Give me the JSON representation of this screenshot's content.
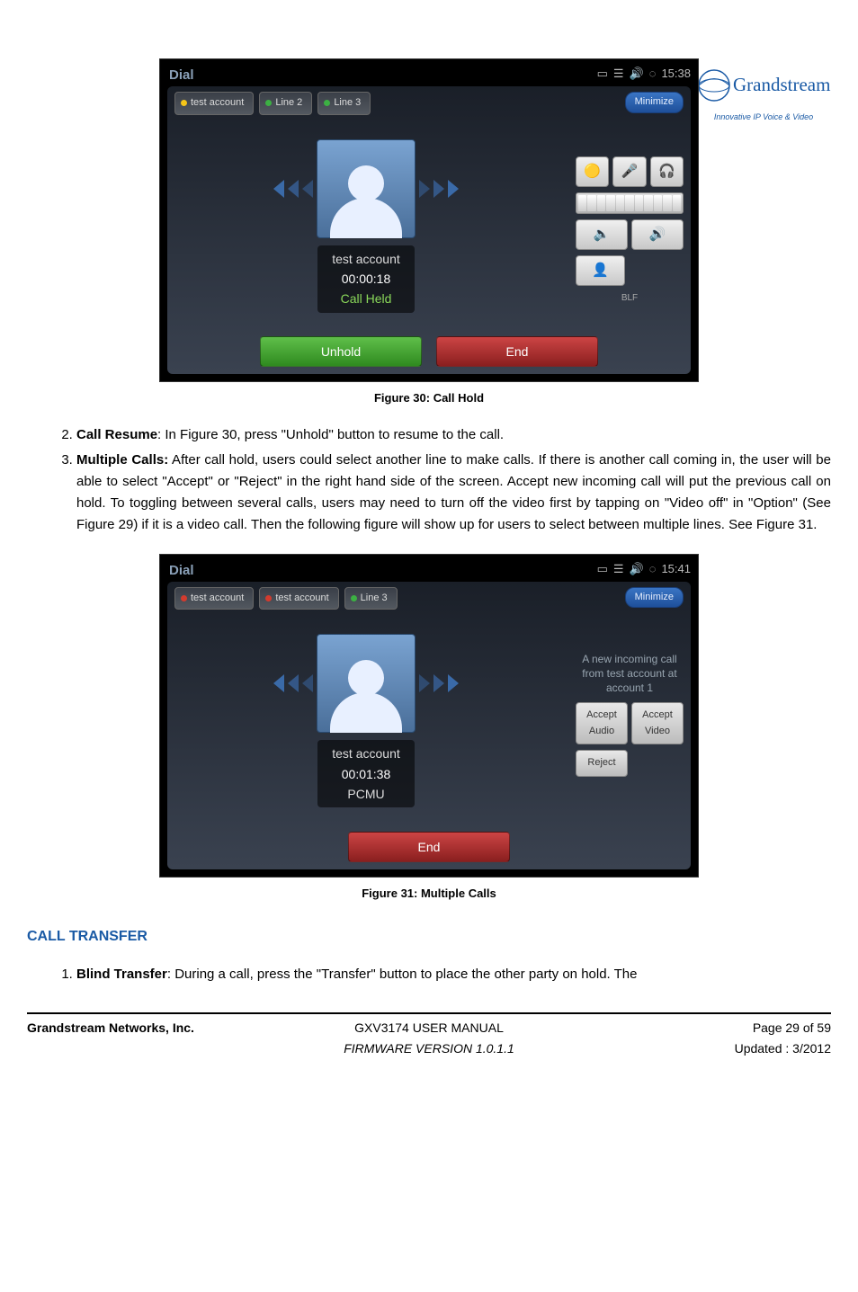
{
  "logo": {
    "brand": "Grandstream",
    "tag": "Innovative IP Voice & Video"
  },
  "fig30": {
    "caption": "Figure 30: Call Hold",
    "window_title": "Dial",
    "clock": "15:38",
    "minimize": "Minimize",
    "tabs": [
      {
        "label": "test account",
        "color": "yellow"
      },
      {
        "label": "Line 2",
        "color": "green"
      },
      {
        "label": "Line 3",
        "color": "green"
      }
    ],
    "call": {
      "name": "test account",
      "time": "00:00:18",
      "status": "Call Held"
    },
    "side_label": "BLF",
    "buttons": {
      "unhold": "Unhold",
      "end": "End"
    }
  },
  "fig31": {
    "caption": "Figure 31: Multiple Calls",
    "window_title": "Dial",
    "clock": "15:41",
    "minimize": "Minimize",
    "tabs": [
      {
        "label": "test account",
        "color": "red"
      },
      {
        "label": "test account",
        "color": "red"
      },
      {
        "label": "Line 3",
        "color": "green"
      }
    ],
    "call": {
      "name": "test account",
      "time": "00:01:38",
      "status": "PCMU"
    },
    "side_info": "A new incoming call from test account at account 1",
    "side_buttons": {
      "accept_audio": "Accept Audio",
      "accept_video": "Accept Video",
      "reject": "Reject"
    },
    "buttons": {
      "end": "End"
    }
  },
  "text": {
    "item2_label": "Call Resume",
    "item2_body": ": In Figure 30, press \"Unhold\" button to resume to the call.",
    "item3_label": "Multiple Calls:",
    "item3_body": " After call hold, users could select another line to make calls. If there is another call coming in, the user will be able to select \"Accept\" or \"Reject\" in the right hand side of the screen. Accept new incoming call will put the previous call on hold. To toggling between several calls, users may need to turn off the video first by tapping on \"Video off\" in \"Option\" (See Figure 29) if it is a video call. Then the following figure will show up for users to select between multiple lines. See Figure 31.",
    "section_heading": "CALL TRANSFER",
    "transfer_item1_label": "Blind Transfer",
    "transfer_item1_body": ": During a call, press the \"Transfer\" button to place the other party on hold. The"
  },
  "footer": {
    "company": "Grandstream Networks, Inc.",
    "manual": "GXV3174 USER MANUAL",
    "firmware": "FIRMWARE VERSION 1.0.1.1",
    "page": "Page 29 of 59",
    "updated": "Updated : 3/2012"
  }
}
